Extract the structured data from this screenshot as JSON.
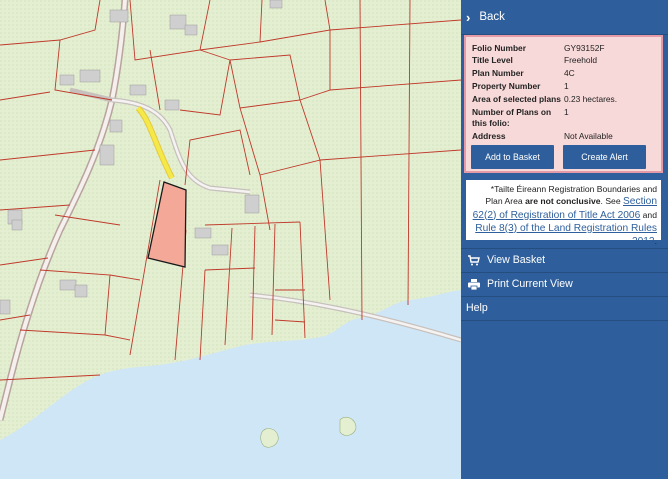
{
  "panel": {
    "back_label": "Back",
    "folio": {
      "rows": [
        {
          "key": "Folio Number",
          "value": "GY93152F"
        },
        {
          "key": "Title Level",
          "value": "Freehold"
        },
        {
          "key": "Plan Number",
          "value": "4C"
        },
        {
          "key": "Property Number",
          "value": "1"
        },
        {
          "key": "Area of selected plans",
          "value": "0.23 hectares."
        },
        {
          "key": "Number of Plans on this folio:",
          "value": "1"
        },
        {
          "key": "Address",
          "value": "Not Available"
        }
      ],
      "add_to_basket": "Add to Basket",
      "create_alert": "Create Alert"
    },
    "notice": {
      "line1": "*Tailte Éireann Registration Boundaries and Plan",
      "area_text": "Area",
      "bold_text": "are not conclusive",
      "see_text": ". See",
      "link1": "Section 62(2) of Registration of Title Act 2006",
      "and_text": "and",
      "link2": "Rule 8(3) of the Land Registration Rules 2012",
      "end": "."
    },
    "menu": {
      "view_basket": "View Basket",
      "print_view": "Print Current View",
      "help": "Help"
    }
  },
  "map": {
    "colors": {
      "land": "#e4efd2",
      "water": "#cfe6f6",
      "parcel_line": "#c0392b",
      "selected_fill": "#f4a898",
      "road_highlight": "#f5e94a",
      "building": "#cfcfcf"
    }
  }
}
